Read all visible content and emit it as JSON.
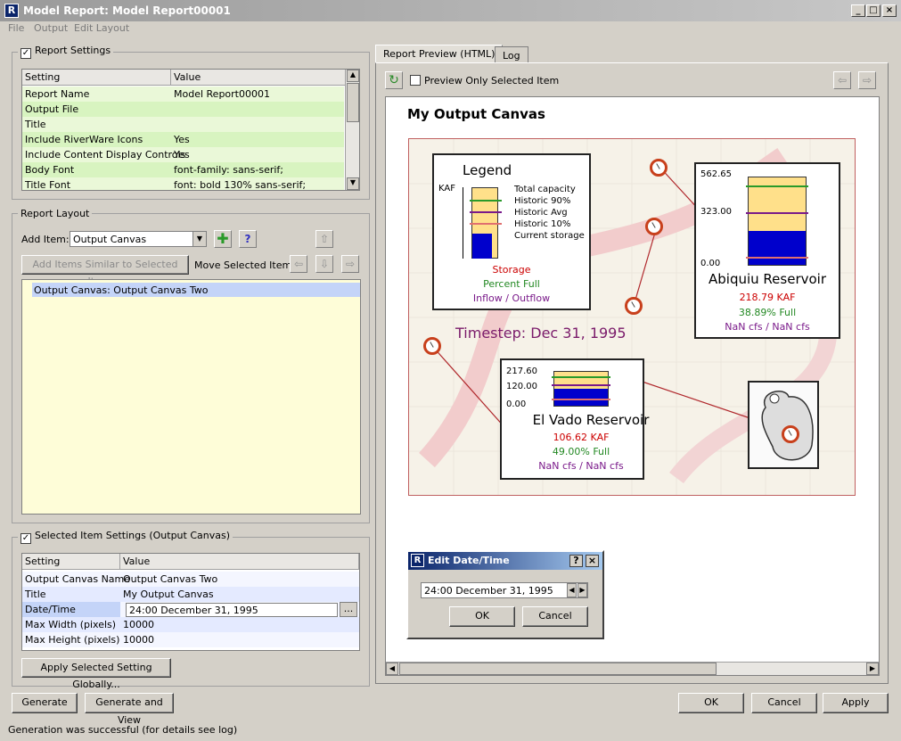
{
  "window": {
    "title": "Model Report: Model Report00001",
    "icon_letter": "R",
    "min": "_",
    "max": "□",
    "close": "×"
  },
  "menu": [
    "File",
    "Output",
    "Edit Layout"
  ],
  "report_settings": {
    "legend": "Report Settings",
    "checked": true,
    "columns": [
      "Setting",
      "Value"
    ],
    "rows": [
      {
        "setting": "Report Name",
        "value": "Model Report00001"
      },
      {
        "setting": "Output File",
        "value": ""
      },
      {
        "setting": "Title",
        "value": ""
      },
      {
        "setting": "Include RiverWare Icons",
        "value": "Yes"
      },
      {
        "setting": "Include Content Display Controls",
        "value": "Yes"
      },
      {
        "setting": "Body Font",
        "value": "font-family: sans-serif;"
      },
      {
        "setting": "Title Font",
        "value": "font: bold 130% sans-serif;"
      }
    ]
  },
  "report_layout": {
    "legend": "Report Layout",
    "add_item_label": "Add Item:",
    "add_item_value": "Output Canvas",
    "add_similar_label": "Add Items Similar to Selected Item ...",
    "move_label": "Move Selected Item:",
    "items": [
      "Output Canvas: Output Canvas Two"
    ]
  },
  "selected_settings": {
    "legend": "Selected Item Settings (Output Canvas)",
    "checked": true,
    "columns": [
      "Setting",
      "Value"
    ],
    "rows": [
      {
        "setting": "Output Canvas Name",
        "value": "Output Canvas Two"
      },
      {
        "setting": "Title",
        "value": "My Output Canvas"
      },
      {
        "setting": "Date/Time",
        "value": "24:00 December 31, 1995"
      },
      {
        "setting": "Max Width (pixels)",
        "value": "10000"
      },
      {
        "setting": "Max Height (pixels)",
        "value": "10000"
      }
    ],
    "apply_globally": "Apply Selected Setting Globally...",
    "ellipsis": "..."
  },
  "buttons": {
    "generate": "Generate",
    "generate_view": "Generate and View",
    "ok": "OK",
    "cancel": "Cancel",
    "apply": "Apply"
  },
  "status": "Generation was successful (for details see log)",
  "tabs": [
    "Report Preview (HTML)",
    "Log"
  ],
  "preview": {
    "only_selected": "Preview Only Selected Item",
    "canvas_title": "My Output Canvas",
    "legend": {
      "title": "Legend",
      "unit": "KAF",
      "lines": [
        "Total capacity",
        "Historic 90%",
        "Historic Avg",
        "Historic 10%",
        "Current storage"
      ],
      "storage": "Storage",
      "percent": "Percent Full",
      "flow": "Inflow / Outflow"
    },
    "timestep": "Timestep: Dec 31, 1995",
    "abiquiu": {
      "name": "Abiquiu Reservoir",
      "top": "562.65",
      "mid": "323.00",
      "bot": "0.00",
      "storage": "218.79 KAF",
      "full": "38.89% Full",
      "flow": "NaN cfs / NaN cfs"
    },
    "elvado": {
      "name": "El Vado Reservoir",
      "top": "217.60",
      "mid": "120.00",
      "bot": "0.00",
      "storage": "106.62 KAF",
      "full": "49.00% Full",
      "flow": "NaN cfs / NaN cfs"
    }
  },
  "dialog": {
    "title": "Edit Date/Time",
    "help": "?",
    "close": "×",
    "value": "24:00 December 31, 1995",
    "ok": "OK",
    "cancel": "Cancel"
  },
  "colors": {
    "storage": "#cc0000",
    "percent": "#228822",
    "flow": "#7a1a8a",
    "fill": "#0000cc",
    "capacity": "#ffe08a"
  }
}
